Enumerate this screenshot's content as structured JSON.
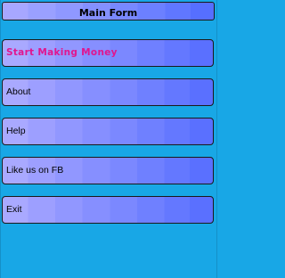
{
  "window": {
    "title": "Main Form"
  },
  "menu": {
    "items": [
      {
        "id": "start",
        "label": "Start Making Money"
      },
      {
        "id": "about",
        "label": "About"
      },
      {
        "id": "help",
        "label": "Help"
      },
      {
        "id": "fb",
        "label": "Like us on FB"
      },
      {
        "id": "exit",
        "label": "Exit"
      }
    ]
  },
  "colors": {
    "background": "#18a7e6",
    "button_gradient_start": "#a9a9ff",
    "button_gradient_end": "#5a70ff",
    "primary_label": "#e0168f"
  }
}
